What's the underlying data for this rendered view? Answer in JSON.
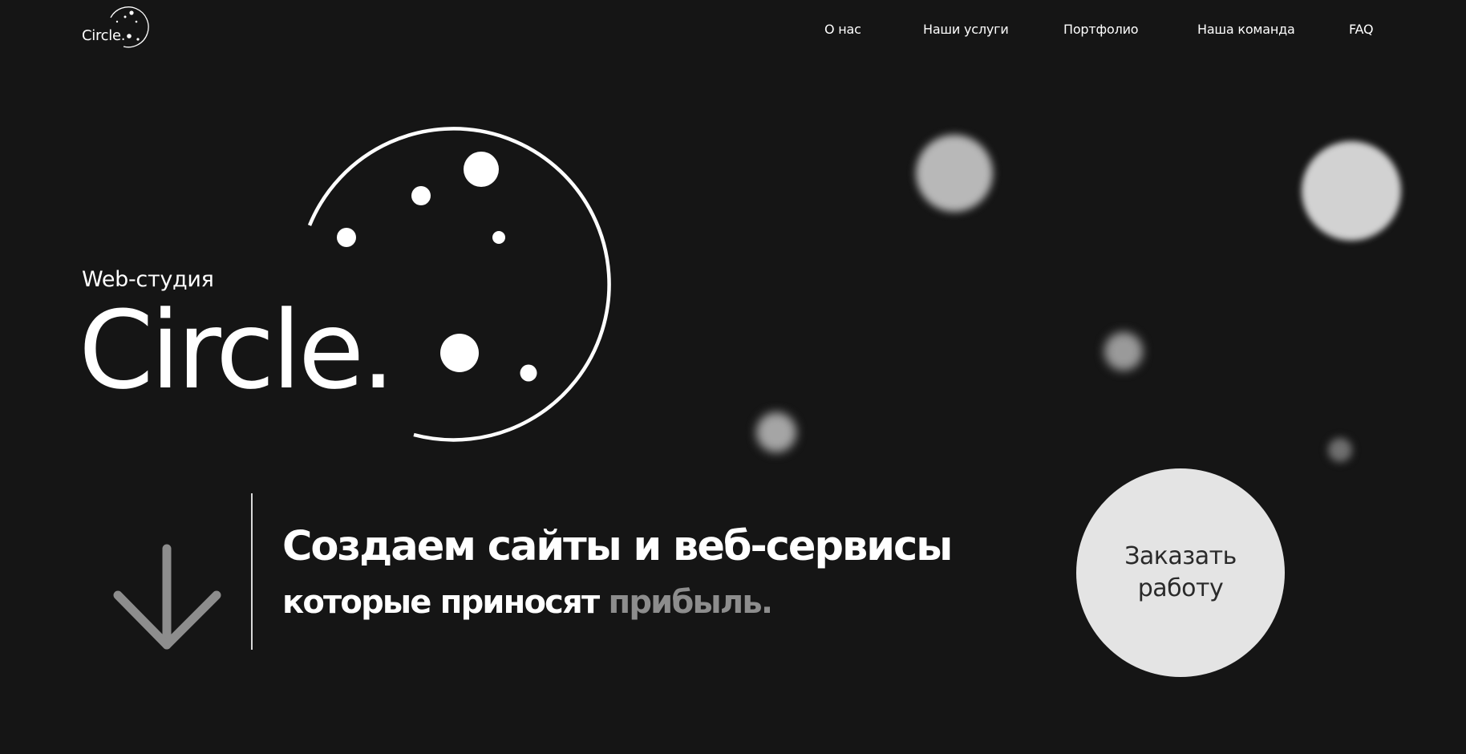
{
  "logo": {
    "text": "Circle."
  },
  "nav": {
    "items": [
      {
        "label": "О нас"
      },
      {
        "label": "Наши услуги"
      },
      {
        "label": "Портфолио"
      },
      {
        "label": "Наша команда"
      },
      {
        "label": "FAQ"
      }
    ]
  },
  "hero": {
    "subtitle": "Web-студия",
    "brand": "Circle.",
    "headline": "Создаем сайты и веб-сервисы",
    "subline_main": "которые приносят",
    "subline_accent": "прибыль."
  },
  "cta": {
    "line1": "Заказать",
    "line2": "работу"
  },
  "icons": {
    "scroll": "arrow-down-icon",
    "orbit": "planet-orbit-icon"
  },
  "colors": {
    "background": "#151515",
    "text": "#ffffff",
    "accent_gray": "#8d8d8d",
    "button_bg": "#e4e4e4",
    "button_text": "#2a2a2a"
  }
}
